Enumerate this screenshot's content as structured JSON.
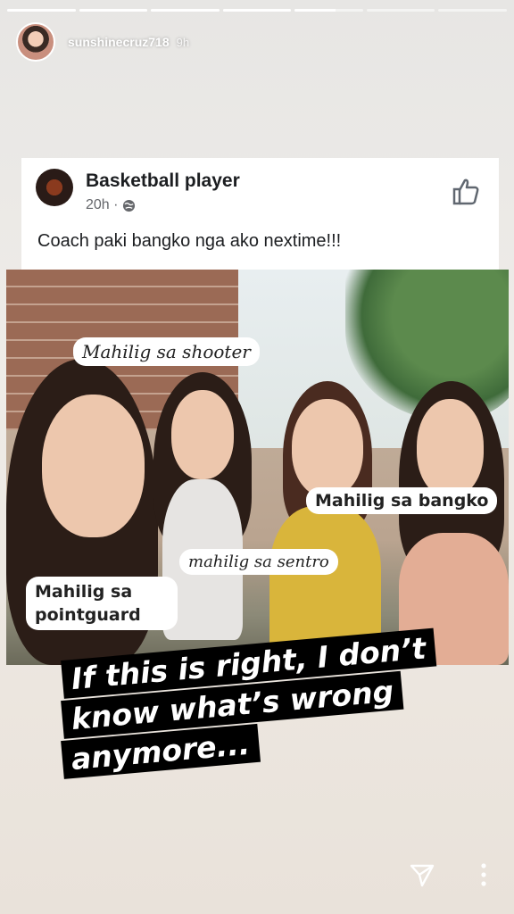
{
  "story": {
    "progress": [
      1,
      1,
      1,
      1,
      0.6,
      0,
      0
    ]
  },
  "header": {
    "username": "sunshinecruz718",
    "time": "9h"
  },
  "post": {
    "page_name": "Basketball player",
    "time": "20h ·",
    "text": "Coach paki bangko nga ako nextime!!!"
  },
  "labels": {
    "shooter": "Mahilig sa shooter",
    "bangko": "Mahilig sa bangko",
    "sentro": "mahilig sa sentro",
    "pointguard": "Mahilig sa pointguard"
  },
  "caption": {
    "lines": [
      "If this is right, I don’t",
      "know what’s wrong",
      "anymore..."
    ]
  },
  "icons": {
    "send": "send-icon",
    "more": "more-vertical-icon",
    "like": "thumbs-up-icon",
    "globe": "globe-icon"
  }
}
